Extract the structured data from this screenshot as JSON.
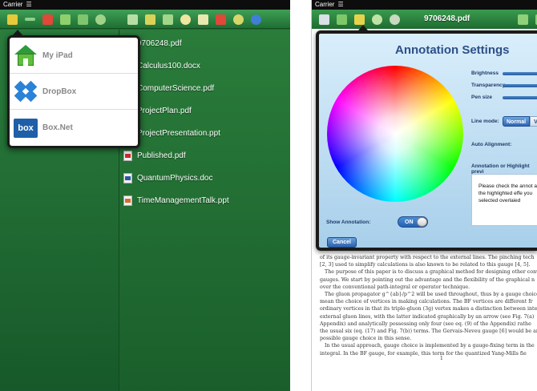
{
  "left_screen": {
    "status": {
      "carrier": "Carrier",
      "wifi_icon": "wifi-icon"
    },
    "toolbar_left_icons": [
      "import-icon",
      "minus-icon",
      "delete-icon",
      "add-icon",
      "move-icon",
      "refresh-icon"
    ],
    "toolbar_right_icons": [
      "mail-icon",
      "folder-icon",
      "add-file-icon",
      "upload-icon",
      "document-icon",
      "delete-icon",
      "sync-icon",
      "info-icon"
    ],
    "popover_items": [
      {
        "label": "My iPad",
        "icon": "home-icon"
      },
      {
        "label": "DropBox",
        "icon": "dropbox-icon"
      },
      {
        "label": "Box.Net",
        "icon": "box-icon",
        "icon_text": "box"
      }
    ],
    "files": [
      {
        "name": "9706248.pdf",
        "type": "pdf"
      },
      {
        "name": "Calculus100.docx",
        "type": "doc"
      },
      {
        "name": "ComputerScience.pdf",
        "type": "pdf"
      },
      {
        "name": "ProjectPlan.pdf",
        "type": "pdf"
      },
      {
        "name": "ProjectPresentation.ppt",
        "type": "ppt"
      },
      {
        "name": "Published.pdf",
        "type": "pdf"
      },
      {
        "name": "QuantumPhysics.doc",
        "type": "doc"
      },
      {
        "name": "TimeManagementTalk.ppt",
        "type": "ppt"
      }
    ]
  },
  "right_screen": {
    "status": {
      "carrier": "Carrier",
      "wifi_icon": "wifi-icon"
    },
    "toolbar_icons": [
      "save-icon",
      "home-icon",
      "pen-icon",
      "circle-icon",
      "undo-icon"
    ],
    "toolbar_right_icons": [
      "back-icon",
      "forward-icon"
    ],
    "document_title": "9706248.pdf",
    "dialog": {
      "title": "Annotation Settings",
      "settings": [
        "Brightness",
        "Transparency",
        "Pen size"
      ],
      "line_mode_label": "Line mode:",
      "line_mode_options": [
        "Normal",
        "V"
      ],
      "line_mode_selected": "Normal",
      "auto_alignment_label": "Auto Alignment:",
      "annotation_highlight_label": "Annotation or Highlight previ",
      "preview_text": "Please check the annot and the highlighted effe you selected overlaied",
      "show_annotation_label": "Show Annotation:",
      "toggle_label": "ON",
      "toggle_state": true,
      "cancel_label": "Cancel"
    },
    "doc_lines": [
      "of its gauge-invariant property with respect to the external lines. The pinching tech",
      "[2, 3] used to simplify calculations is also known to be related to this gauge [4, 5].",
      "The purpose of this paper is to discuss a graphical method for designing other conv",
      "gauges. We start by pointing out the advantage and the flexibility of the graphical n",
      "over the conventional path-integral or operator technique.",
      "The gluon propagator g^{ab}/p^2 will be used throughout, thus by a gauge choice we",
      "mean the choice of vertices in making calculations. The BF vertices are different fr",
      "ordinary vertices in that its triple-gluon (3g) vertex makes a distinction between interna",
      "external gluon lines, with the latter indicated graphically by an arrow (see Fig. 7(a)",
      "Appendix) and analytically possessing only four (see eq. (9) of the Appendix) rathe",
      "the usual six (eq. (17) and Fig. 7(b)) terms. The Gervais-Neveu gauge [6] would be an",
      "possible gauge choice in this sense.",
      "In the usual approach, gauge choice is implemented by a gauge-fixing term in the",
      "integral. In the BF gauge, for example, this term for the quantized Yang-Mills fie"
    ],
    "page_number": "1"
  }
}
